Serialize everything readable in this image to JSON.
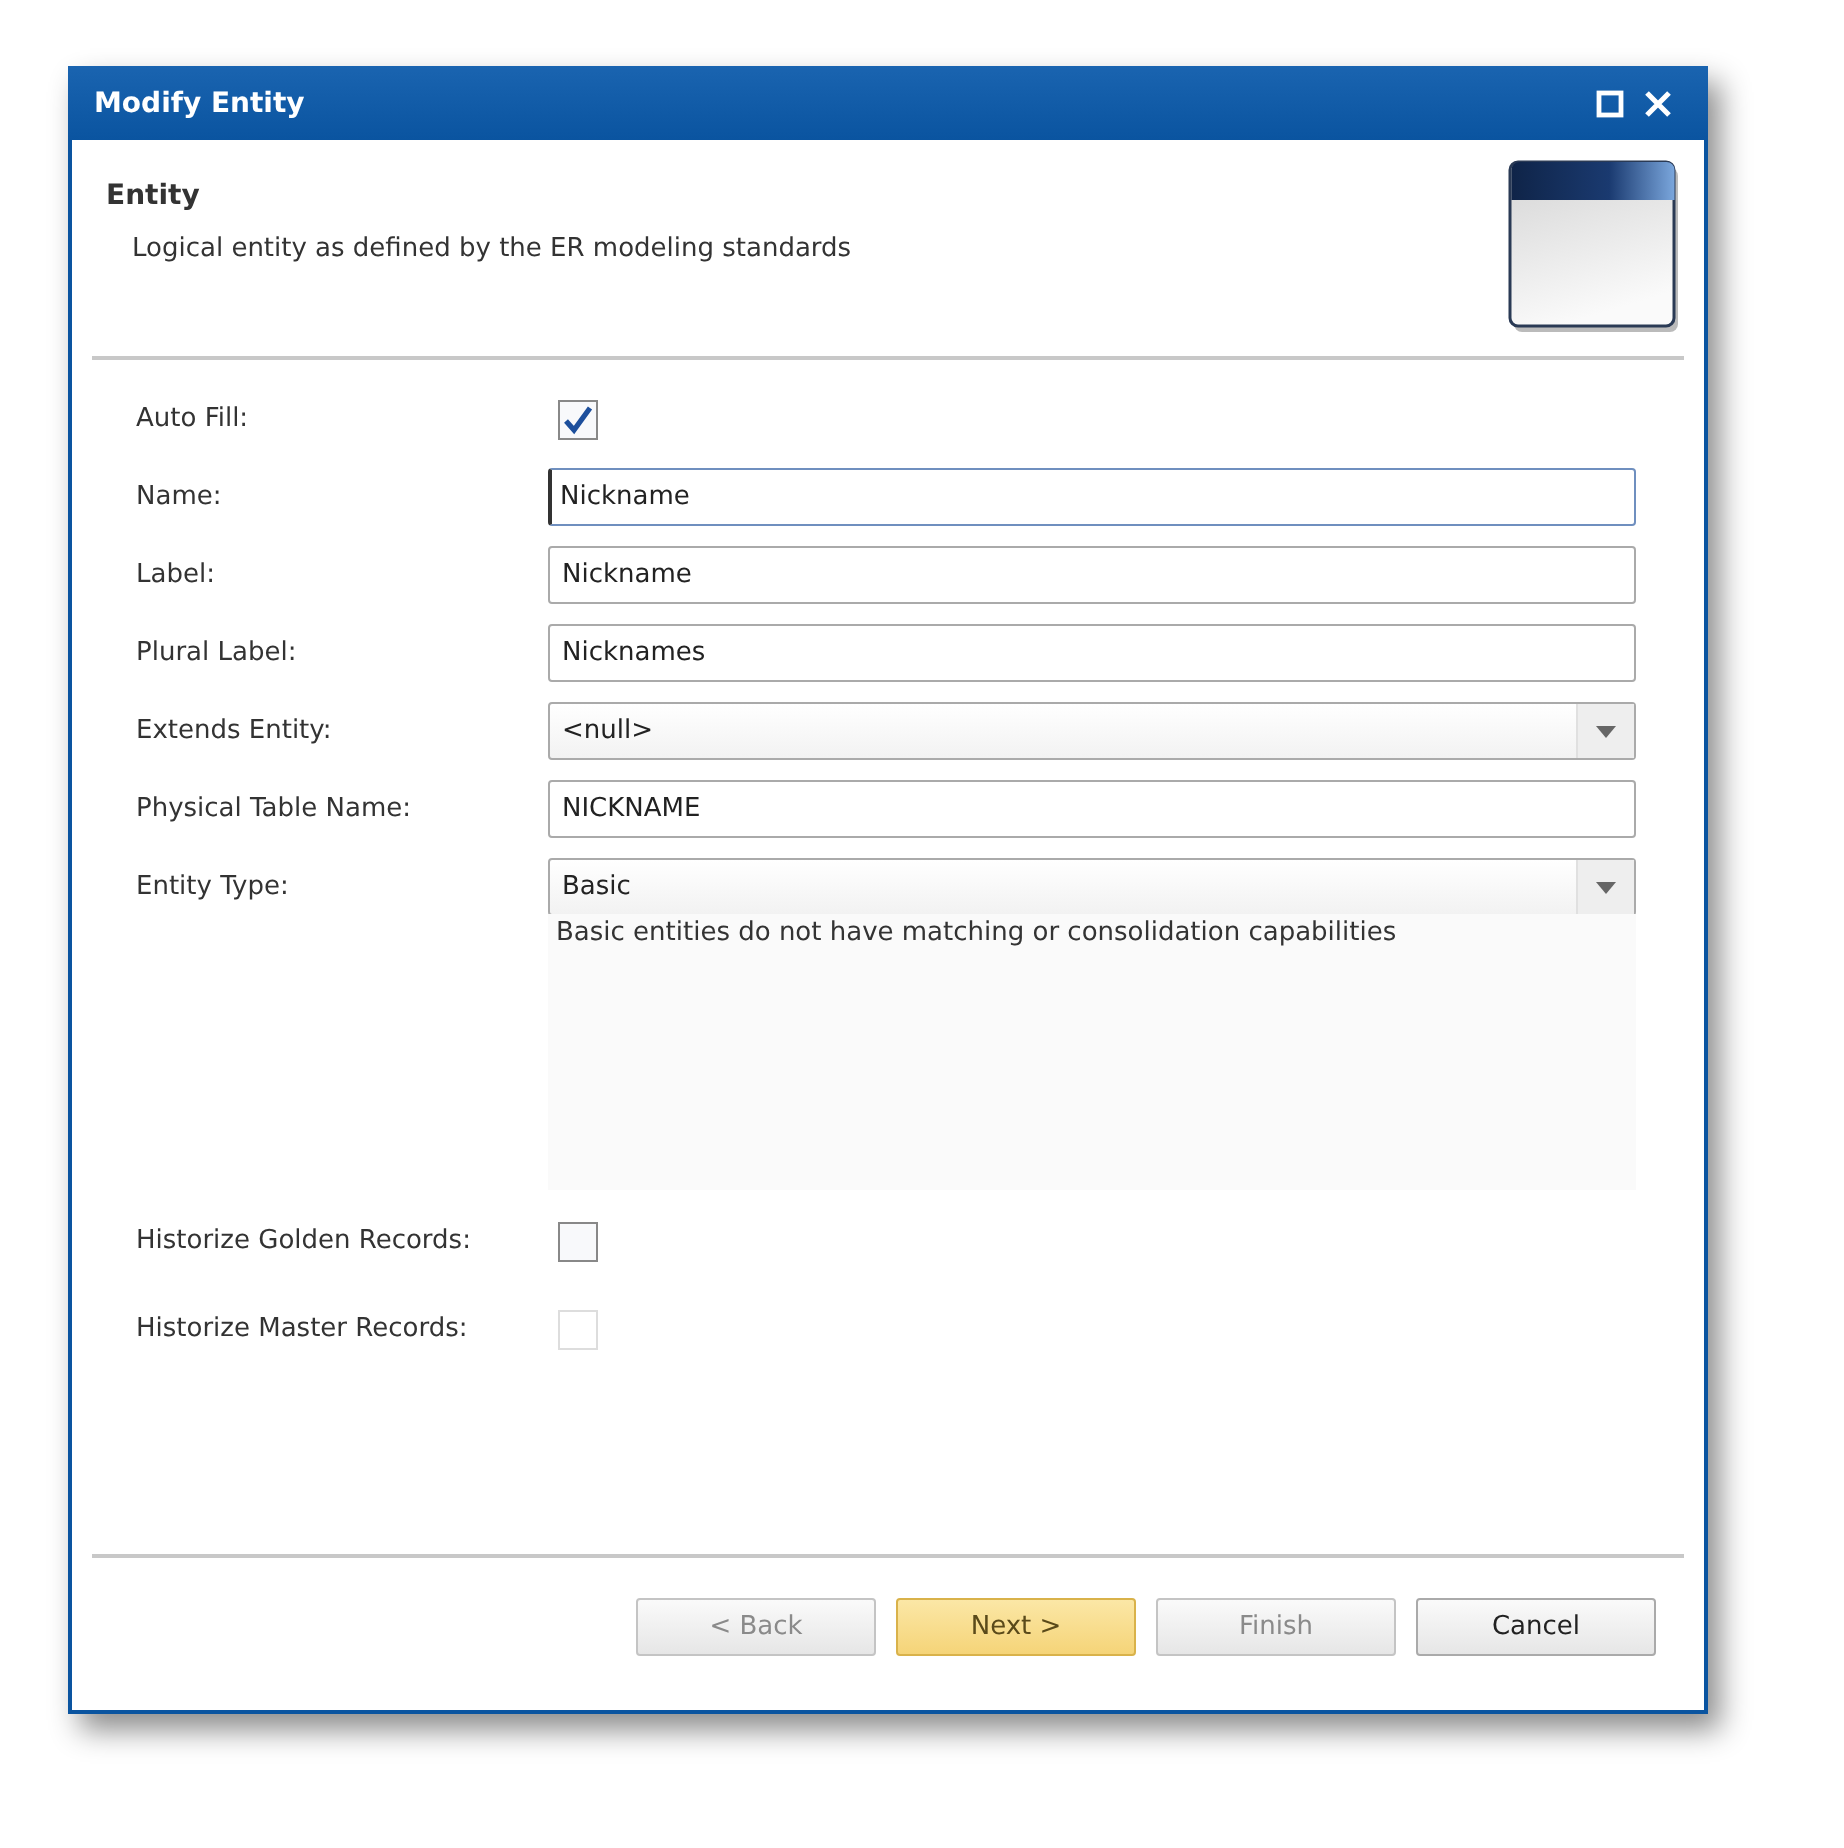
{
  "window": {
    "title": "Modify Entity"
  },
  "header": {
    "title": "Entity",
    "description": "Logical entity as defined by the ER modeling standards"
  },
  "fields": [
    {
      "kind": "checkbox",
      "label": "Auto Fill:",
      "checked": true,
      "disabled": false
    },
    {
      "kind": "text",
      "label": "Name:",
      "value": "Nickname",
      "focused": true
    },
    {
      "kind": "text",
      "label": "Label:",
      "value": "Nickname",
      "focused": false
    },
    {
      "kind": "text",
      "label": "Plural Label:",
      "value": "Nicknames",
      "focused": false
    },
    {
      "kind": "select",
      "label": "Extends Entity:",
      "value": "<null>"
    },
    {
      "kind": "text",
      "label": "Physical Table Name:",
      "value": "NICKNAME",
      "focused": false
    },
    {
      "kind": "select",
      "label": "Entity Type:",
      "value": "Basic"
    },
    {
      "kind": "description",
      "text": "Basic entities do not have matching or consolidation capabilities"
    },
    {
      "kind": "checkbox",
      "label": "Historize Golden Records:",
      "checked": false,
      "disabled": false
    },
    {
      "kind": "checkbox",
      "label": "Historize Master Records:",
      "checked": false,
      "disabled": true
    }
  ],
  "buttons": [
    {
      "label": "< Back",
      "disabled": true,
      "default": false
    },
    {
      "label": "Next >",
      "disabled": false,
      "default": true
    },
    {
      "label": "Finish",
      "disabled": true,
      "default": false
    },
    {
      "label": "Cancel",
      "disabled": false,
      "default": false
    }
  ]
}
